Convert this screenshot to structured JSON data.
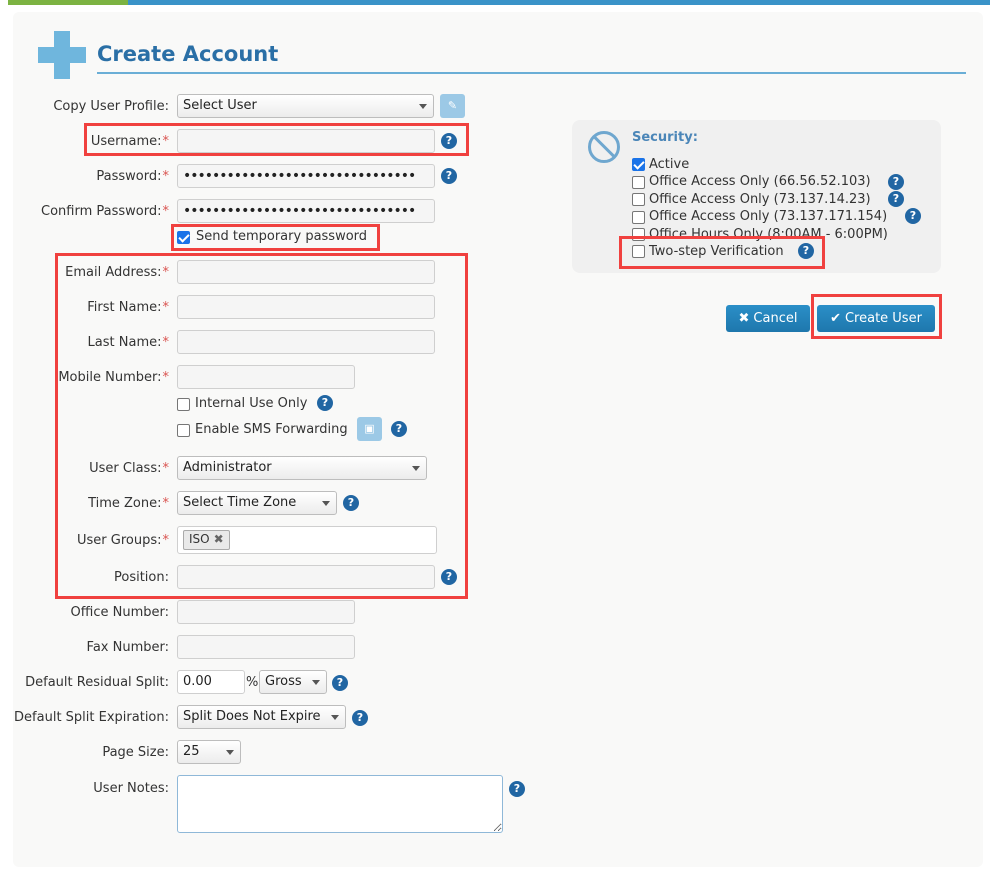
{
  "page": {
    "title": "Create Account"
  },
  "form": {
    "copy_profile": {
      "label": "Copy User Profile:",
      "value": "Select User"
    },
    "username": {
      "label": "Username:",
      "value": ""
    },
    "password": {
      "label": "Password:",
      "value": "••••••••••••••••••••••••••••••••"
    },
    "confirm_password": {
      "label": "Confirm Password:",
      "value": "••••••••••••••••••••••••••••••••"
    },
    "send_temp_password": {
      "label": "Send temporary password",
      "checked": true
    },
    "email": {
      "label": "Email Address:",
      "value": ""
    },
    "first_name": {
      "label": "First Name:",
      "value": ""
    },
    "last_name": {
      "label": "Last Name:",
      "value": ""
    },
    "mobile": {
      "label": "Mobile Number:",
      "value": ""
    },
    "internal_use": {
      "label": "Internal Use Only",
      "checked": false
    },
    "sms_forwarding": {
      "label": "Enable SMS Forwarding",
      "checked": false
    },
    "user_class": {
      "label": "User Class:",
      "value": "Administrator"
    },
    "time_zone": {
      "label": "Time Zone:",
      "value": "Select Time Zone"
    },
    "user_groups": {
      "label": "User Groups:",
      "tags": [
        "ISO"
      ]
    },
    "position": {
      "label": "Position:",
      "value": ""
    },
    "office_number": {
      "label": "Office Number:",
      "value": ""
    },
    "fax_number": {
      "label": "Fax Number:",
      "value": ""
    },
    "residual_split": {
      "label": "Default Residual Split:",
      "value": "0.00",
      "unit": "%",
      "type": "Gross"
    },
    "split_expiration": {
      "label": "Default Split Expiration:",
      "value": "Split Does Not Expire"
    },
    "page_size": {
      "label": "Page Size:",
      "value": "25"
    },
    "notes": {
      "label": "User Notes:",
      "value": ""
    }
  },
  "security": {
    "title": "Security:",
    "options": [
      {
        "label": "Active",
        "checked": true
      },
      {
        "label": "Office Access Only (66.56.52.103)",
        "checked": false
      },
      {
        "label": "Office Access Only (73.137.14.23)",
        "checked": false
      },
      {
        "label": "Office Access Only (73.137.171.154)",
        "checked": false
      },
      {
        "label": "Office Hours Only (8:00AM - 6:00PM)",
        "checked": false
      },
      {
        "label": "Two-step Verification",
        "checked": false
      }
    ]
  },
  "actions": {
    "cancel": "Cancel",
    "create": "Create User"
  },
  "icons": {
    "help": "?",
    "cancel": "✖",
    "create": "✔",
    "tag_remove": "✖"
  },
  "colors": {
    "accent": "#2166a3",
    "highlight": "#f0413f",
    "button": "#2b8fc8"
  }
}
